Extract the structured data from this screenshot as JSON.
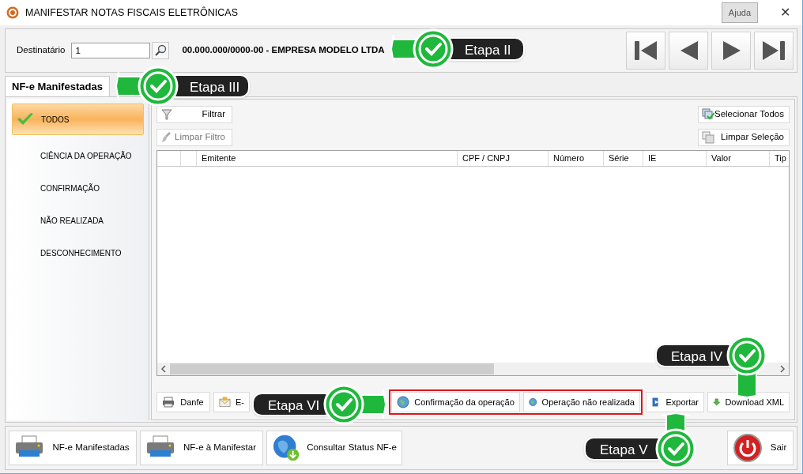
{
  "window": {
    "title": "MANIFESTAR NOTAS FISCAIS ELETRÔNICAS",
    "help_button": "Ajuda",
    "close_button": "✕"
  },
  "recipient": {
    "label": "Destinatário",
    "value": "1",
    "company": "00.000.000/0000-00 - EMPRESA MODELO LTDA"
  },
  "tabs": [
    {
      "label": "NF-e Manifestadas",
      "selected": true
    }
  ],
  "sidebar": {
    "items": [
      {
        "label": "TODOS",
        "selected": true
      },
      {
        "label": "CIÊNCIA DA OPERAÇÃO",
        "selected": false
      },
      {
        "label": "CONFIRMAÇÃO",
        "selected": false
      },
      {
        "label": "NÃO REALIZADA",
        "selected": false
      },
      {
        "label": "DESCONHECIMENTO",
        "selected": false
      }
    ]
  },
  "filter_buttons": [
    {
      "label": "Filtrar",
      "disabled": false
    },
    {
      "label": "Limpar Filtro",
      "disabled": true
    }
  ],
  "selection_buttons": [
    {
      "label": "Selecionar Todos"
    },
    {
      "label": "Limpar Seleção"
    }
  ],
  "table": {
    "columns": [
      "Emitente",
      "CPF / CNPJ",
      "Número",
      "Série",
      "IE",
      "Valor",
      "Tip"
    ]
  },
  "actions_left": [
    {
      "label": "Danfe"
    },
    {
      "label": "E-"
    }
  ],
  "highlighted_actions": [
    {
      "label": "Confirmação da operação"
    },
    {
      "label": "Operação não realizada"
    }
  ],
  "actions_right": [
    {
      "label": "Exportar"
    },
    {
      "label": "Download XML"
    }
  ],
  "bottom_buttons": [
    {
      "label": "NF-e Manifestadas"
    },
    {
      "label": "NF-e à Manifestar"
    },
    {
      "label": "Consultar Status NF-e"
    },
    {
      "label": "Sair"
    }
  ],
  "callouts": [
    {
      "label": "Etapa II"
    },
    {
      "label": "Etapa III"
    },
    {
      "label": "Etapa IV"
    },
    {
      "label": "Etapa V"
    },
    {
      "label": "Etapa VI"
    }
  ]
}
